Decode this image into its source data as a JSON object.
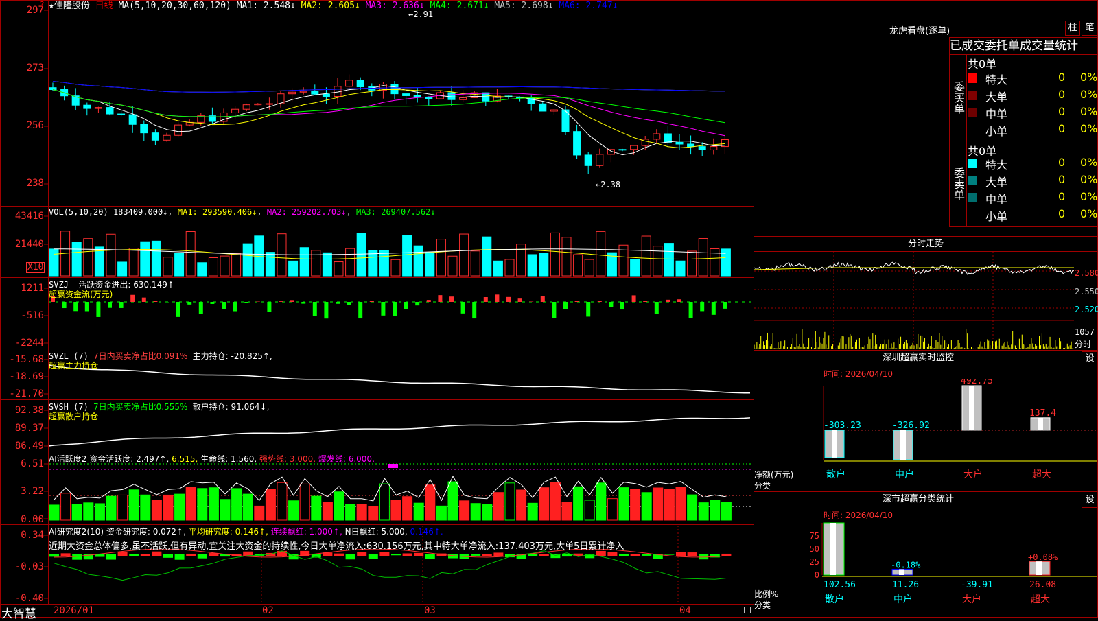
{
  "kchart": {
    "star": "★",
    "stock_name": "佳隆股份",
    "period": "日线",
    "ma_spec": "MA(5,10,20,30,60,120)",
    "ma": [
      {
        "label": "MA1: 2.548↓",
        "color": "#ffffff"
      },
      {
        "label": "MA2: 2.605↓",
        "color": "#ffff00"
      },
      {
        "label": "MA3: 2.636↓",
        "color": "#ff00ff"
      },
      {
        "label": "MA4: 2.671↓",
        "color": "#00ff00"
      },
      {
        "label": "MA5: 2.698↓",
        "color": "#c0c0c0"
      },
      {
        "label": "MA6: 2.747↓",
        "color": "#0000ff"
      }
    ],
    "y_labels": [
      "297",
      "273",
      "256",
      "238"
    ],
    "high_label": "2.91",
    "low_label": "2.38"
  },
  "vol": {
    "title": "VOL(5,10,20)",
    "value": "183409.000↓",
    "ma1": "MA1: 293590.406↓",
    "ma2": "MA2: 259202.703↓",
    "ma3": "MA3: 269407.562↓",
    "y_labels": [
      "43416",
      "21440"
    ],
    "unit": "X10"
  },
  "svzj": {
    "title": "SVZJ",
    "value": "活跃资金进出: 630.149↑",
    "subtitle": "超赢资金流(万元)",
    "y_labels": [
      "1211",
      "-516",
      "-2244"
    ]
  },
  "svzl": {
    "title": "SVZL (7)",
    "ratio": "7日内买卖净占比0.091%",
    "hold": "主力持仓: -20.825↑,",
    "subtitle": "超赢主力持仓",
    "y_labels": [
      "-15.68",
      "-18.69",
      "-21.70"
    ]
  },
  "svsh": {
    "title": "SVSH (7)",
    "ratio": "7日内买卖净占比0.555%",
    "hold": "散户持仓: 91.064↓,",
    "subtitle": "超赢散户持仓",
    "y_labels": [
      "92.38",
      "89.37",
      "86.49"
    ]
  },
  "ai_active": {
    "title": "AI活跃度2",
    "degree": "资金活跃度: 2.497↑,",
    "v2": "6.515,",
    "life": "生命线: 1.560,",
    "strong": "强势线: 3.000,",
    "burst": "爆发线: 6.000,",
    "y_labels": [
      "6.51",
      "3.22",
      "0.00"
    ]
  },
  "ai_research": {
    "title": "AI研究度2(10)",
    "research": "资金研究度: 0.072↑,",
    "avg": "平均研究度: 0.146↑,",
    "red": "连续飘红: 1.000↑,",
    "n_red": "N日飘红: 5.000,",
    "last": "0.146↑.",
    "commentary": "近期大资金总体偏多,虽不活跃,但有异动,宜关注大资金的持续性,今日大单净流入:630.156万元,其中特大单净流入:137.403万元,大单5日累计净入",
    "y_labels": [
      "0.34",
      "-0.03",
      "-0.40"
    ]
  },
  "bottom": {
    "brand": "大智慧",
    "dates": [
      "2026/01",
      "02",
      "03",
      "04"
    ]
  },
  "right": {
    "longhu_title": "龙虎看盘(逐单)",
    "btn_zhu": "柱",
    "btn_bi": "笔",
    "stats_header": "已成交委托单成交量统计",
    "buy": {
      "total": "共0单",
      "side_label": "委买单",
      "rows": [
        {
          "color": "#ff0000",
          "name": "特大",
          "count": "0",
          "pct": "0%"
        },
        {
          "color": "#800000",
          "name": "大单",
          "count": "0",
          "pct": "0%"
        },
        {
          "color": "#6e0000",
          "name": "中单",
          "count": "0",
          "pct": "0%"
        },
        {
          "color": "#000000",
          "name": "小单",
          "count": "0",
          "pct": "0%"
        }
      ]
    },
    "sell": {
      "total": "共0单",
      "side_label": "委卖单",
      "rows": [
        {
          "color": "#00ffff",
          "name": "特大",
          "count": "0",
          "pct": "0%"
        },
        {
          "color": "#008080",
          "name": "大单",
          "count": "0",
          "pct": "0%"
        },
        {
          "color": "#006e6e",
          "name": "中单",
          "count": "0",
          "pct": "0%"
        },
        {
          "color": "#000000",
          "name": "小单",
          "count": "0",
          "pct": "0%"
        }
      ]
    },
    "intraday": {
      "title": "分时走势",
      "y_labels": [
        "2.580",
        "2.550",
        "2.520"
      ],
      "vol_label": "1057",
      "vol_unit": "分时"
    },
    "sz_monitor": {
      "title": "深圳超赢实时监控",
      "btn": "设",
      "time": "时间: 2026/04/10",
      "y_labels": [
        "492.75",
        "219.53",
        "-53.7",
        "-326.92"
      ],
      "left_label_1": "净额(万元)",
      "left_label_2": "分类",
      "bar_values": [
        "-303.23",
        "-326.92",
        "492.75",
        "137.4"
      ],
      "categories": [
        "散户",
        "中户",
        "大户",
        "超大"
      ]
    },
    "sz_class": {
      "title": "深市超赢分类统计",
      "btn": "设",
      "time": "时间: 2026/04/10",
      "y_labels": [
        "75",
        "50",
        "25",
        "0"
      ],
      "left_label_1": "比例%",
      "left_label_2": "分类",
      "bar_values": [
        "102.56",
        "11.26",
        "-39.91",
        "26.08"
      ],
      "top_labels": [
        "",
        "-0.18%",
        "",
        "+0.08%"
      ],
      "categories": [
        "散户",
        "中户",
        "大户",
        "超大"
      ]
    }
  },
  "chart_data": [
    {
      "type": "bar",
      "title": "深圳超赢实时监控",
      "categories": [
        "散户",
        "中户",
        "大户",
        "超大"
      ],
      "values": [
        -303.23,
        -326.92,
        492.75,
        137.4
      ],
      "ylabel": "净额(万元)",
      "ylim": [
        -326.92,
        492.75
      ]
    },
    {
      "type": "bar",
      "title": "深市超赢分类统计",
      "categories": [
        "散户",
        "中户",
        "大户",
        "超大"
      ],
      "values": [
        102.56,
        11.26,
        -39.91,
        26.08
      ],
      "ylabel": "比例%",
      "ylim": [
        0,
        100
      ]
    }
  ]
}
